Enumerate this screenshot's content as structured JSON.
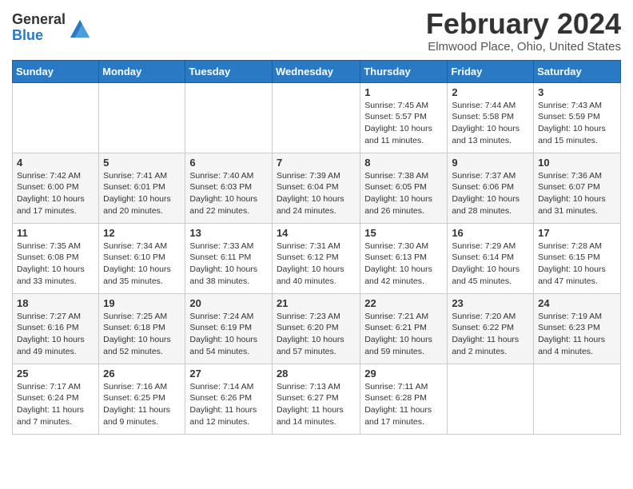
{
  "header": {
    "logo_general": "General",
    "logo_blue": "Blue",
    "month_year": "February 2024",
    "location": "Elmwood Place, Ohio, United States"
  },
  "days_of_week": [
    "Sunday",
    "Monday",
    "Tuesday",
    "Wednesday",
    "Thursday",
    "Friday",
    "Saturday"
  ],
  "weeks": [
    [
      {
        "day": "",
        "info": ""
      },
      {
        "day": "",
        "info": ""
      },
      {
        "day": "",
        "info": ""
      },
      {
        "day": "",
        "info": ""
      },
      {
        "day": "1",
        "info": "Sunrise: 7:45 AM\nSunset: 5:57 PM\nDaylight: 10 hours and 11 minutes."
      },
      {
        "day": "2",
        "info": "Sunrise: 7:44 AM\nSunset: 5:58 PM\nDaylight: 10 hours and 13 minutes."
      },
      {
        "day": "3",
        "info": "Sunrise: 7:43 AM\nSunset: 5:59 PM\nDaylight: 10 hours and 15 minutes."
      }
    ],
    [
      {
        "day": "4",
        "info": "Sunrise: 7:42 AM\nSunset: 6:00 PM\nDaylight: 10 hours and 17 minutes."
      },
      {
        "day": "5",
        "info": "Sunrise: 7:41 AM\nSunset: 6:01 PM\nDaylight: 10 hours and 20 minutes."
      },
      {
        "day": "6",
        "info": "Sunrise: 7:40 AM\nSunset: 6:03 PM\nDaylight: 10 hours and 22 minutes."
      },
      {
        "day": "7",
        "info": "Sunrise: 7:39 AM\nSunset: 6:04 PM\nDaylight: 10 hours and 24 minutes."
      },
      {
        "day": "8",
        "info": "Sunrise: 7:38 AM\nSunset: 6:05 PM\nDaylight: 10 hours and 26 minutes."
      },
      {
        "day": "9",
        "info": "Sunrise: 7:37 AM\nSunset: 6:06 PM\nDaylight: 10 hours and 28 minutes."
      },
      {
        "day": "10",
        "info": "Sunrise: 7:36 AM\nSunset: 6:07 PM\nDaylight: 10 hours and 31 minutes."
      }
    ],
    [
      {
        "day": "11",
        "info": "Sunrise: 7:35 AM\nSunset: 6:08 PM\nDaylight: 10 hours and 33 minutes."
      },
      {
        "day": "12",
        "info": "Sunrise: 7:34 AM\nSunset: 6:10 PM\nDaylight: 10 hours and 35 minutes."
      },
      {
        "day": "13",
        "info": "Sunrise: 7:33 AM\nSunset: 6:11 PM\nDaylight: 10 hours and 38 minutes."
      },
      {
        "day": "14",
        "info": "Sunrise: 7:31 AM\nSunset: 6:12 PM\nDaylight: 10 hours and 40 minutes."
      },
      {
        "day": "15",
        "info": "Sunrise: 7:30 AM\nSunset: 6:13 PM\nDaylight: 10 hours and 42 minutes."
      },
      {
        "day": "16",
        "info": "Sunrise: 7:29 AM\nSunset: 6:14 PM\nDaylight: 10 hours and 45 minutes."
      },
      {
        "day": "17",
        "info": "Sunrise: 7:28 AM\nSunset: 6:15 PM\nDaylight: 10 hours and 47 minutes."
      }
    ],
    [
      {
        "day": "18",
        "info": "Sunrise: 7:27 AM\nSunset: 6:16 PM\nDaylight: 10 hours and 49 minutes."
      },
      {
        "day": "19",
        "info": "Sunrise: 7:25 AM\nSunset: 6:18 PM\nDaylight: 10 hours and 52 minutes."
      },
      {
        "day": "20",
        "info": "Sunrise: 7:24 AM\nSunset: 6:19 PM\nDaylight: 10 hours and 54 minutes."
      },
      {
        "day": "21",
        "info": "Sunrise: 7:23 AM\nSunset: 6:20 PM\nDaylight: 10 hours and 57 minutes."
      },
      {
        "day": "22",
        "info": "Sunrise: 7:21 AM\nSunset: 6:21 PM\nDaylight: 10 hours and 59 minutes."
      },
      {
        "day": "23",
        "info": "Sunrise: 7:20 AM\nSunset: 6:22 PM\nDaylight: 11 hours and 2 minutes."
      },
      {
        "day": "24",
        "info": "Sunrise: 7:19 AM\nSunset: 6:23 PM\nDaylight: 11 hours and 4 minutes."
      }
    ],
    [
      {
        "day": "25",
        "info": "Sunrise: 7:17 AM\nSunset: 6:24 PM\nDaylight: 11 hours and 7 minutes."
      },
      {
        "day": "26",
        "info": "Sunrise: 7:16 AM\nSunset: 6:25 PM\nDaylight: 11 hours and 9 minutes."
      },
      {
        "day": "27",
        "info": "Sunrise: 7:14 AM\nSunset: 6:26 PM\nDaylight: 11 hours and 12 minutes."
      },
      {
        "day": "28",
        "info": "Sunrise: 7:13 AM\nSunset: 6:27 PM\nDaylight: 11 hours and 14 minutes."
      },
      {
        "day": "29",
        "info": "Sunrise: 7:11 AM\nSunset: 6:28 PM\nDaylight: 11 hours and 17 minutes."
      },
      {
        "day": "",
        "info": ""
      },
      {
        "day": "",
        "info": ""
      }
    ]
  ]
}
